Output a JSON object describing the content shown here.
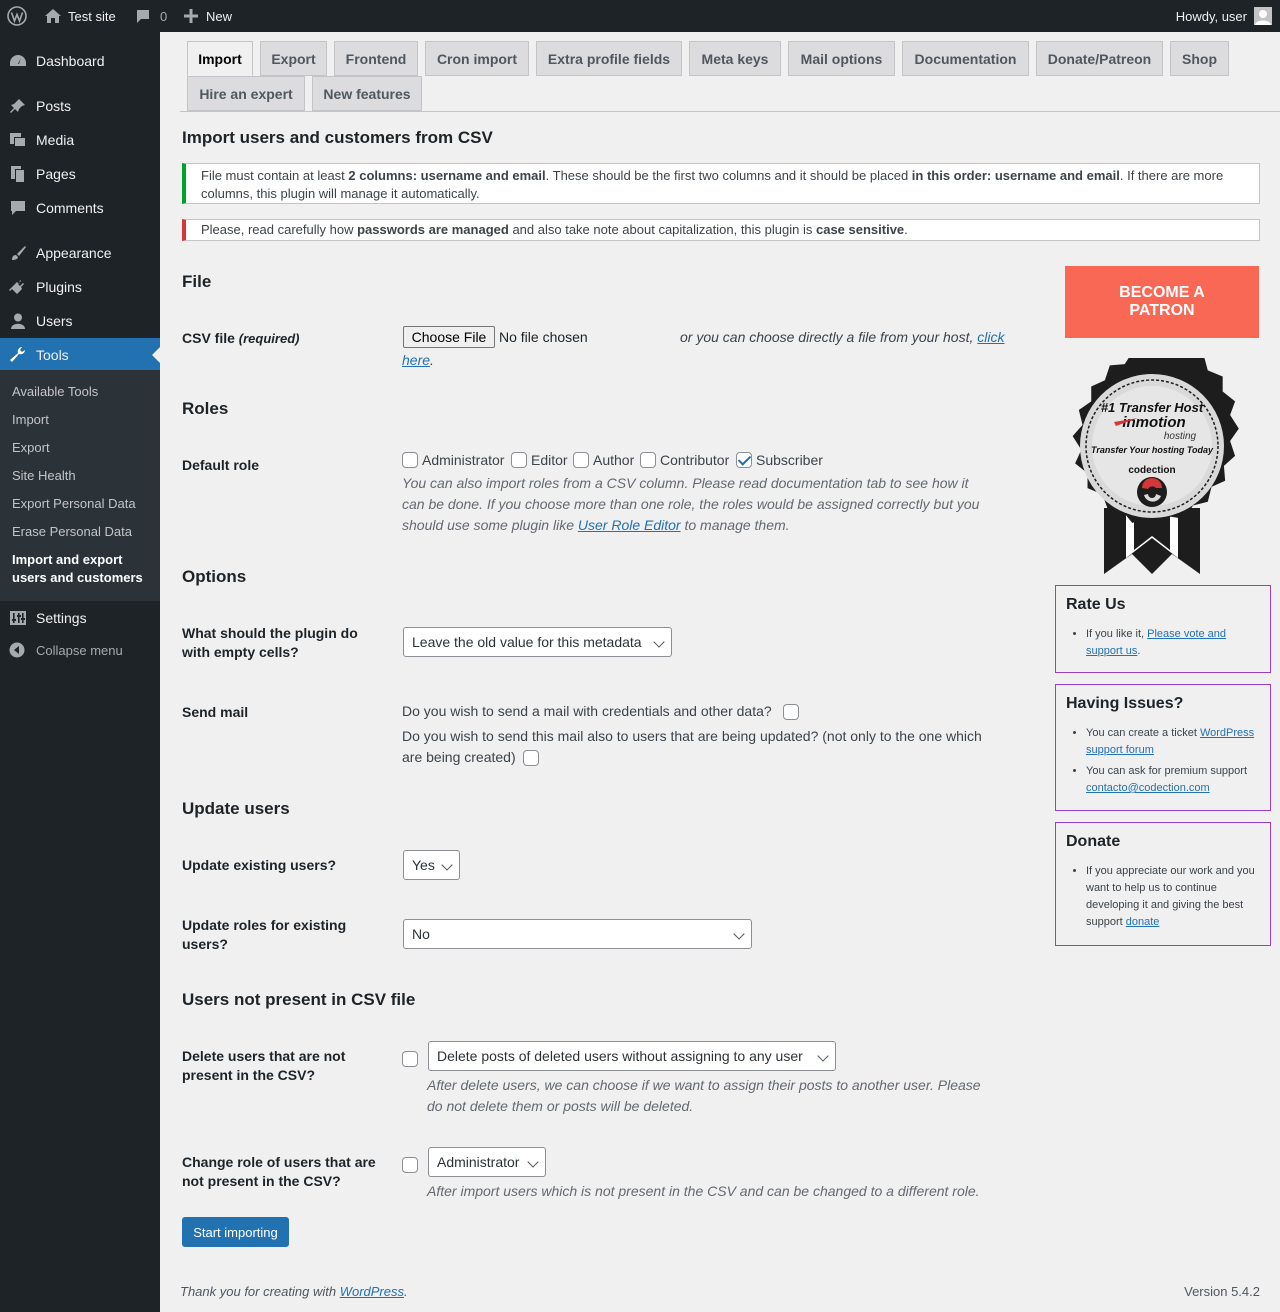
{
  "adminbar": {
    "site_name": "Test site",
    "comments_count": "0",
    "new_label": "New",
    "howdy": "Howdy, user"
  },
  "menu": {
    "dashboard": "Dashboard",
    "posts": "Posts",
    "media": "Media",
    "pages": "Pages",
    "comments": "Comments",
    "appearance": "Appearance",
    "plugins": "Plugins",
    "users": "Users",
    "tools": "Tools",
    "settings": "Settings",
    "collapse": "Collapse menu",
    "tools_sub": {
      "available": "Available Tools",
      "import": "Import",
      "export": "Export",
      "site_health": "Site Health",
      "export_personal": "Export Personal Data",
      "erase_personal": "Erase Personal Data",
      "import_export_line1": "Import and export",
      "import_export_line2": "users and customers"
    }
  },
  "tabs": {
    "import": "Import",
    "export": "Export",
    "frontend": "Frontend",
    "cron": "Cron import",
    "extra": "Extra profile fields",
    "meta": "Meta keys",
    "mail": "Mail options",
    "doc": "Documentation",
    "donate": "Donate/Patreon",
    "shop": "Shop",
    "hire": "Hire an expert",
    "newf": "New features"
  },
  "page": {
    "title": "Import users and customers from CSV",
    "notice1": {
      "a": "File must contain at least ",
      "b": "2 columns: username and email",
      "c": ". These should be the first two columns and it should be placed ",
      "d": "in this order: username and email",
      "e": ". If there are more columns, this plugin will manage it automatically."
    },
    "notice2": {
      "a": "Please, read carefully how ",
      "b": "passwords are managed",
      "c": " and also take note about capitalization, this plugin is ",
      "d": "case sensitive",
      "e": "."
    }
  },
  "file_section": {
    "heading": "File",
    "label": "CSV file",
    "required": "(required)",
    "choose_button": "Choose File",
    "no_file": "No file chosen",
    "host_text": "or you can choose directly a file from your host,",
    "click": "click",
    "here": "here",
    "period": "."
  },
  "roles_section": {
    "heading": "Roles",
    "label": "Default role",
    "roles": [
      "Administrator",
      "Editor",
      "Author",
      "Contributor",
      "Subscriber"
    ],
    "desc_line1": "You can also import roles from a CSV column. Please read documentation tab to see how it",
    "desc_line2": "can be done. If you choose more than one role, the roles would be assigned correctly but you",
    "desc_line3a": "should use some plugin like ",
    "desc_link": "User Role Editor",
    "desc_line3b": " to manage them."
  },
  "options_section": {
    "heading": "Options",
    "empty_label_1": "What should the plugin do",
    "empty_label_2": "with empty cells?",
    "empty_value": "Leave the old value for this metadata",
    "mail_label": "Send mail",
    "mail_q1": "Do you wish to send a mail with credentials and other data?",
    "mail_q2a": "Do you wish to send this mail also to users that are being updated? (not only to the one which",
    "mail_q2b": "are being created)"
  },
  "update_section": {
    "heading": "Update users",
    "existing_label": "Update existing users?",
    "existing_value": "Yes",
    "roles_label_1": "Update roles for existing",
    "roles_label_2": "users?",
    "roles_value": "No"
  },
  "notpresent_section": {
    "heading": "Users not present in CSV file",
    "delete_label_1": "Delete users that are not",
    "delete_label_2": "present in the CSV?",
    "delete_value": "Delete posts of deleted users without assigning to any user",
    "delete_desc_1": "After delete users, we can choose if we want to assign their posts to another user. Please",
    "delete_desc_2": "do not delete them or posts will be deleted.",
    "change_label_1": "Change role of users that are",
    "change_label_2": "not present in the CSV?",
    "change_value": "Administrator",
    "change_desc": "After import users which is not present in the CSV and can be changed to a different role."
  },
  "start_button": "Start importing",
  "sidebar": {
    "patron_line1": "BECOME A",
    "patron_line2": "PATRON",
    "badge": {
      "line1": "#1 Transfer Host",
      "brand": "inmotion",
      "brand_sub": "hosting",
      "tagline": "Transfer Your hosting Today",
      "partner": "codection"
    },
    "rate": {
      "title": "Rate Us",
      "text": "If you like it, ",
      "link": "Please vote and support us",
      "end": "."
    },
    "issues": {
      "title": "Having Issues?",
      "item1_text": "You can create a ticket ",
      "item1_link": "WordPress support forum",
      "item2_text": "You can ask for premium support ",
      "item2_link": "contacto@codection.com"
    },
    "donate": {
      "title": "Donate",
      "text": "If you appreciate our work and you want to help us to continue developing it and giving the best support ",
      "link": "donate"
    }
  },
  "footer": {
    "thanks": "Thank you for creating with ",
    "wp_link": "WordPress",
    "period": ".",
    "version": "Version 5.4.2"
  }
}
